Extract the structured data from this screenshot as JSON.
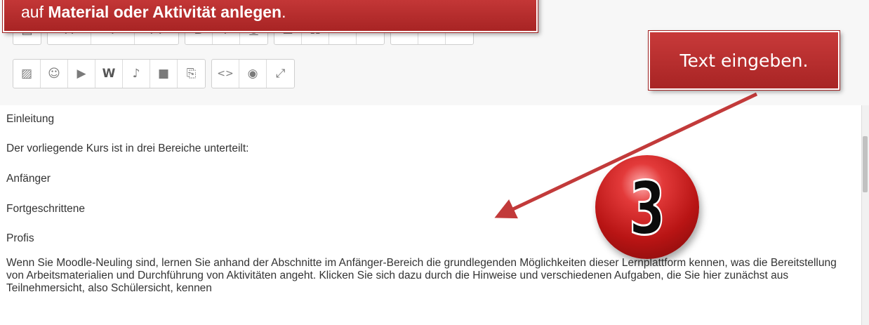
{
  "banner_top": {
    "prefix": "auf ",
    "bold": "Material oder Aktivität anlegen",
    "suffix": "."
  },
  "banner_right": {
    "text": "Text eingeben."
  },
  "badge": {
    "number": "3"
  },
  "toolbar": {
    "row1": [
      {
        "name": "styles-button",
        "glyph": "▤"
      },
      {
        "name": "font-color-button",
        "glyph": "A"
      },
      {
        "name": "font-family-button",
        "glyph": "T"
      },
      {
        "name": "font-size-button",
        "glyph": "T↓"
      },
      {
        "name": "bold-button",
        "glyph": "B"
      },
      {
        "name": "italic-button",
        "glyph": "I"
      },
      {
        "name": "underline-button",
        "glyph": "U"
      },
      {
        "name": "unordered-list-button",
        "glyph": "☰"
      },
      {
        "name": "ordered-list-button",
        "glyph": "☷"
      },
      {
        "name": "align-left-button",
        "glyph": "≡"
      },
      {
        "name": "align-right-button",
        "glyph": "≡"
      },
      {
        "name": "link-button",
        "glyph": "⌁"
      },
      {
        "name": "unlink-button",
        "glyph": "⚯"
      },
      {
        "name": "unlink-alt-button",
        "glyph": "⚮"
      }
    ],
    "row2": [
      {
        "name": "image-button",
        "glyph": "▨"
      },
      {
        "name": "emoticon-button",
        "glyph": "☺"
      },
      {
        "name": "media-button",
        "glyph": "▶"
      },
      {
        "name": "word-import-button",
        "glyph": "W"
      },
      {
        "name": "record-audio-button",
        "glyph": "♪"
      },
      {
        "name": "record-video-button",
        "glyph": "■"
      },
      {
        "name": "paste-button",
        "glyph": "⎘"
      },
      {
        "name": "html-button",
        "glyph": "<>"
      },
      {
        "name": "preview-button",
        "glyph": "◉"
      },
      {
        "name": "fullscreen-button",
        "glyph": "⤢"
      }
    ]
  },
  "content": {
    "lines": [
      "Einleitung",
      "Der vorliegende Kurs ist in drei Bereiche unterteilt:",
      "Anfänger",
      "Fortgeschrittene",
      "Profis"
    ],
    "paragraph": "Wenn Sie Moodle-Neuling sind, lernen Sie anhand der Abschnitte im Anfänger-Bereich die grundlegenden Möglichkeiten dieser Lernplattform kennen, was die Bereitstellung von Arbeitsmaterialien und Durchführung von Aktivitäten angeht. Klicken Sie sich dazu durch die Hinweise und verschiedenen Aufgaben, die Sie hier zunächst aus Teilnehmersicht, also Schülersicht, kennen"
  },
  "colors": {
    "accent": "#b52a2a",
    "arrow": "#c23a3a"
  }
}
